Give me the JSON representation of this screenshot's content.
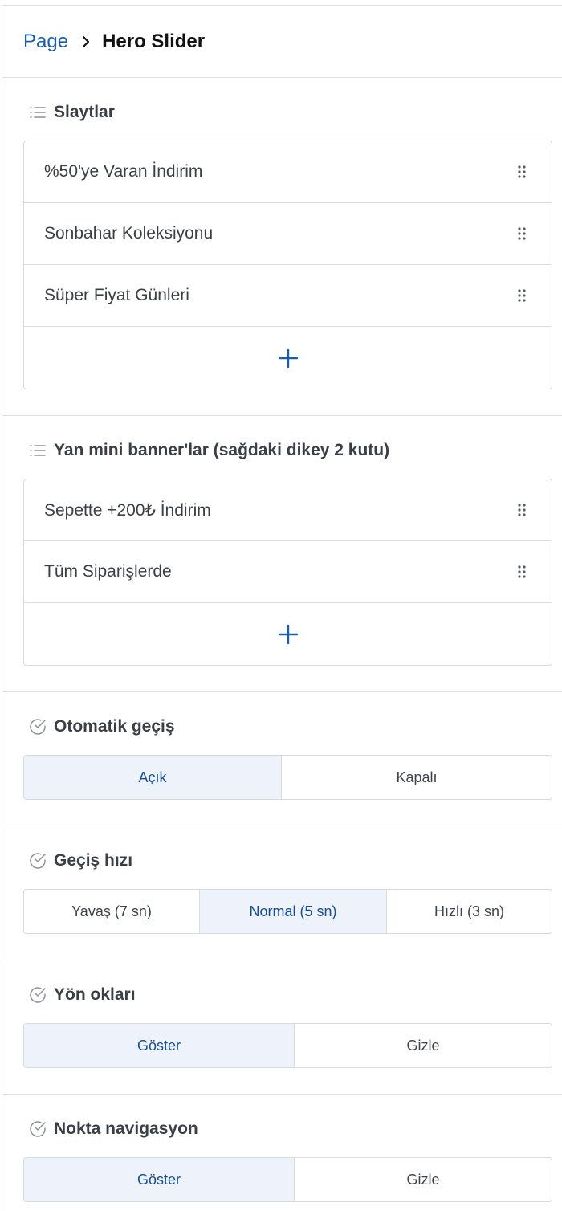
{
  "breadcrumb": {
    "parent": "Page",
    "current": "Hero Slider"
  },
  "slides": {
    "title": "Slaytlar",
    "items": [
      "%50'ye Varan İndirim",
      "Sonbahar Koleksiyonu",
      "Süper Fiyat Günleri"
    ]
  },
  "side_banners": {
    "title": "Yan mini banner'lar (sağdaki dikey 2 kutu)",
    "items": [
      "Sepette +200₺ İndirim",
      "Tüm Siparişlerde"
    ]
  },
  "autoplay": {
    "title": "Otomatik geçiş",
    "options": [
      "Açık",
      "Kapalı"
    ],
    "selected": "Açık"
  },
  "speed": {
    "title": "Geçiş hızı",
    "options": [
      "Yavaş (7 sn)",
      "Normal (5 sn)",
      "Hızlı (3 sn)"
    ],
    "selected": "Normal (5 sn)"
  },
  "arrows": {
    "title": "Yön okları",
    "options": [
      "Göster",
      "Gizle"
    ],
    "selected": "Göster"
  },
  "dots": {
    "title": "Nokta navigasyon",
    "options": [
      "Göster",
      "Gizle"
    ],
    "selected": "Göster"
  },
  "colors": {
    "accent": "#1a5ea8",
    "active_bg": "#eef3fb",
    "border": "#d7dadf"
  },
  "icons": {
    "list": "list-icon",
    "check": "check-circle-icon",
    "drag": "drag-handle-icon",
    "add": "plus-icon",
    "chevron": "chevron-right-icon"
  }
}
